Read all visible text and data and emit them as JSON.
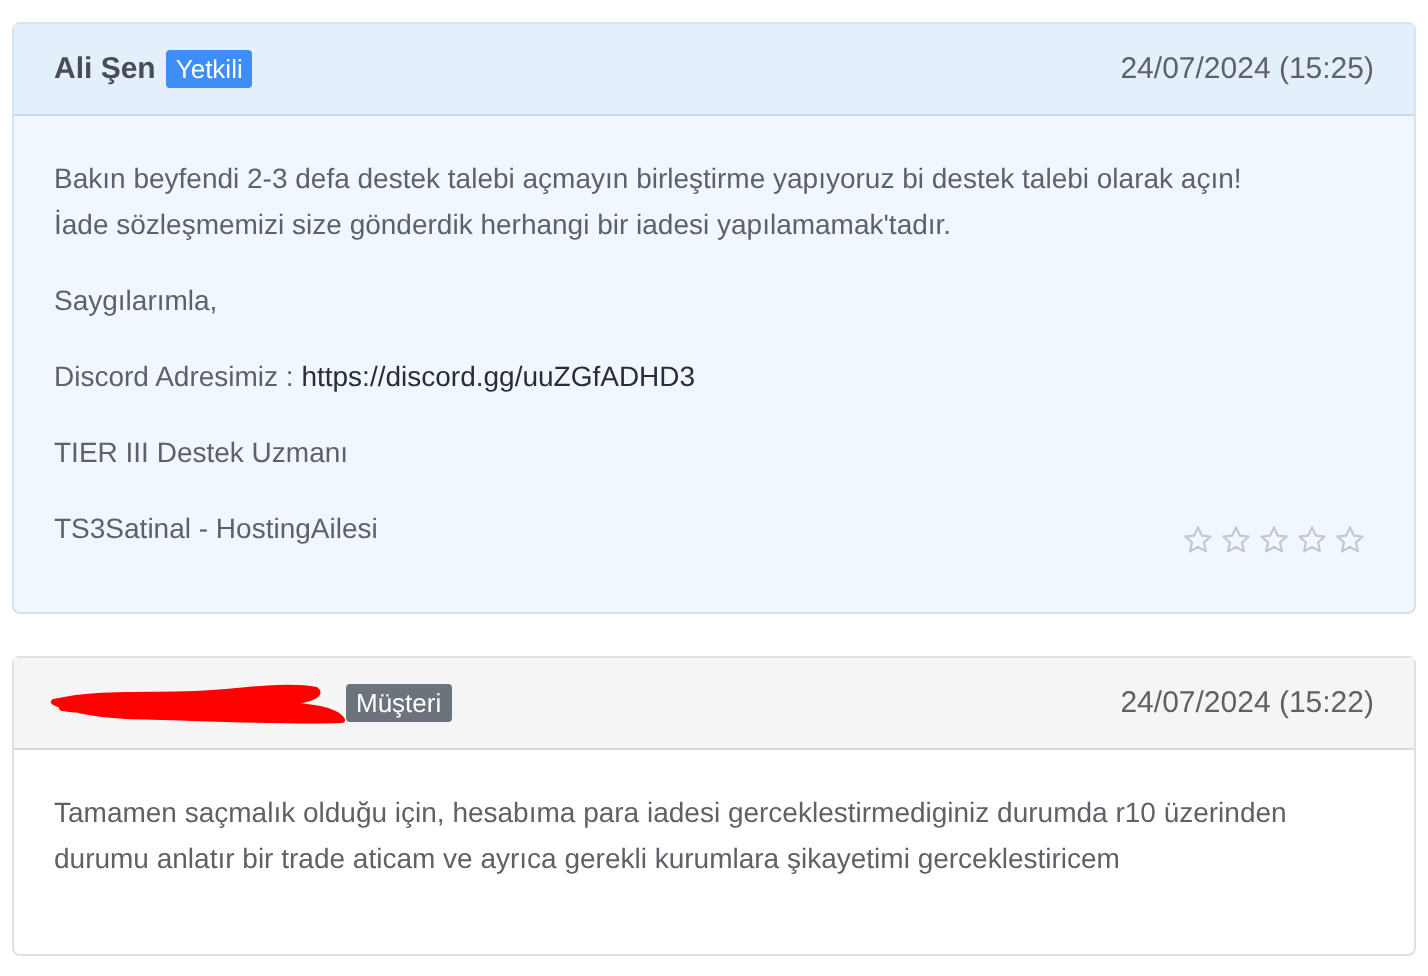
{
  "messages": [
    {
      "kind": "staff",
      "author": "Ali Şen",
      "redacted": false,
      "role": "Yetkili",
      "date": "24/07/2024 (15:25)",
      "paragraphs": [
        {
          "text": "Bakın beyfendi 2-3 defa destek talebi açmayın birleştirme yapıyoruz bi destek talebi olarak açın!\nİade sözleşmemizi size gönderdik herhangi bir iadesi yapılamamak'tadır."
        },
        {
          "text": "Saygılarımla,"
        },
        {
          "text": "Discord Adresimiz :",
          "link": "https://discord.gg/uuZGfADHD3"
        },
        {
          "text": "TIER III Destek Uzmanı"
        },
        {
          "text": "TS3Satinal - HostingAilesi"
        }
      ],
      "stars": 0
    },
    {
      "kind": "client",
      "redacted": true,
      "role": "Müşteri",
      "date": "24/07/2024 (15:22)",
      "paragraphs": [
        {
          "text": "Tamamen saçmalık olduğu için, hesabıma para iadesi gerceklestirmediginiz durumda r10 üzerinden\ndurumu anlatır bir trade aticam ve ayrıca gerekli kurumlara şikayetimi gerceklestiricem"
        }
      ]
    }
  ]
}
